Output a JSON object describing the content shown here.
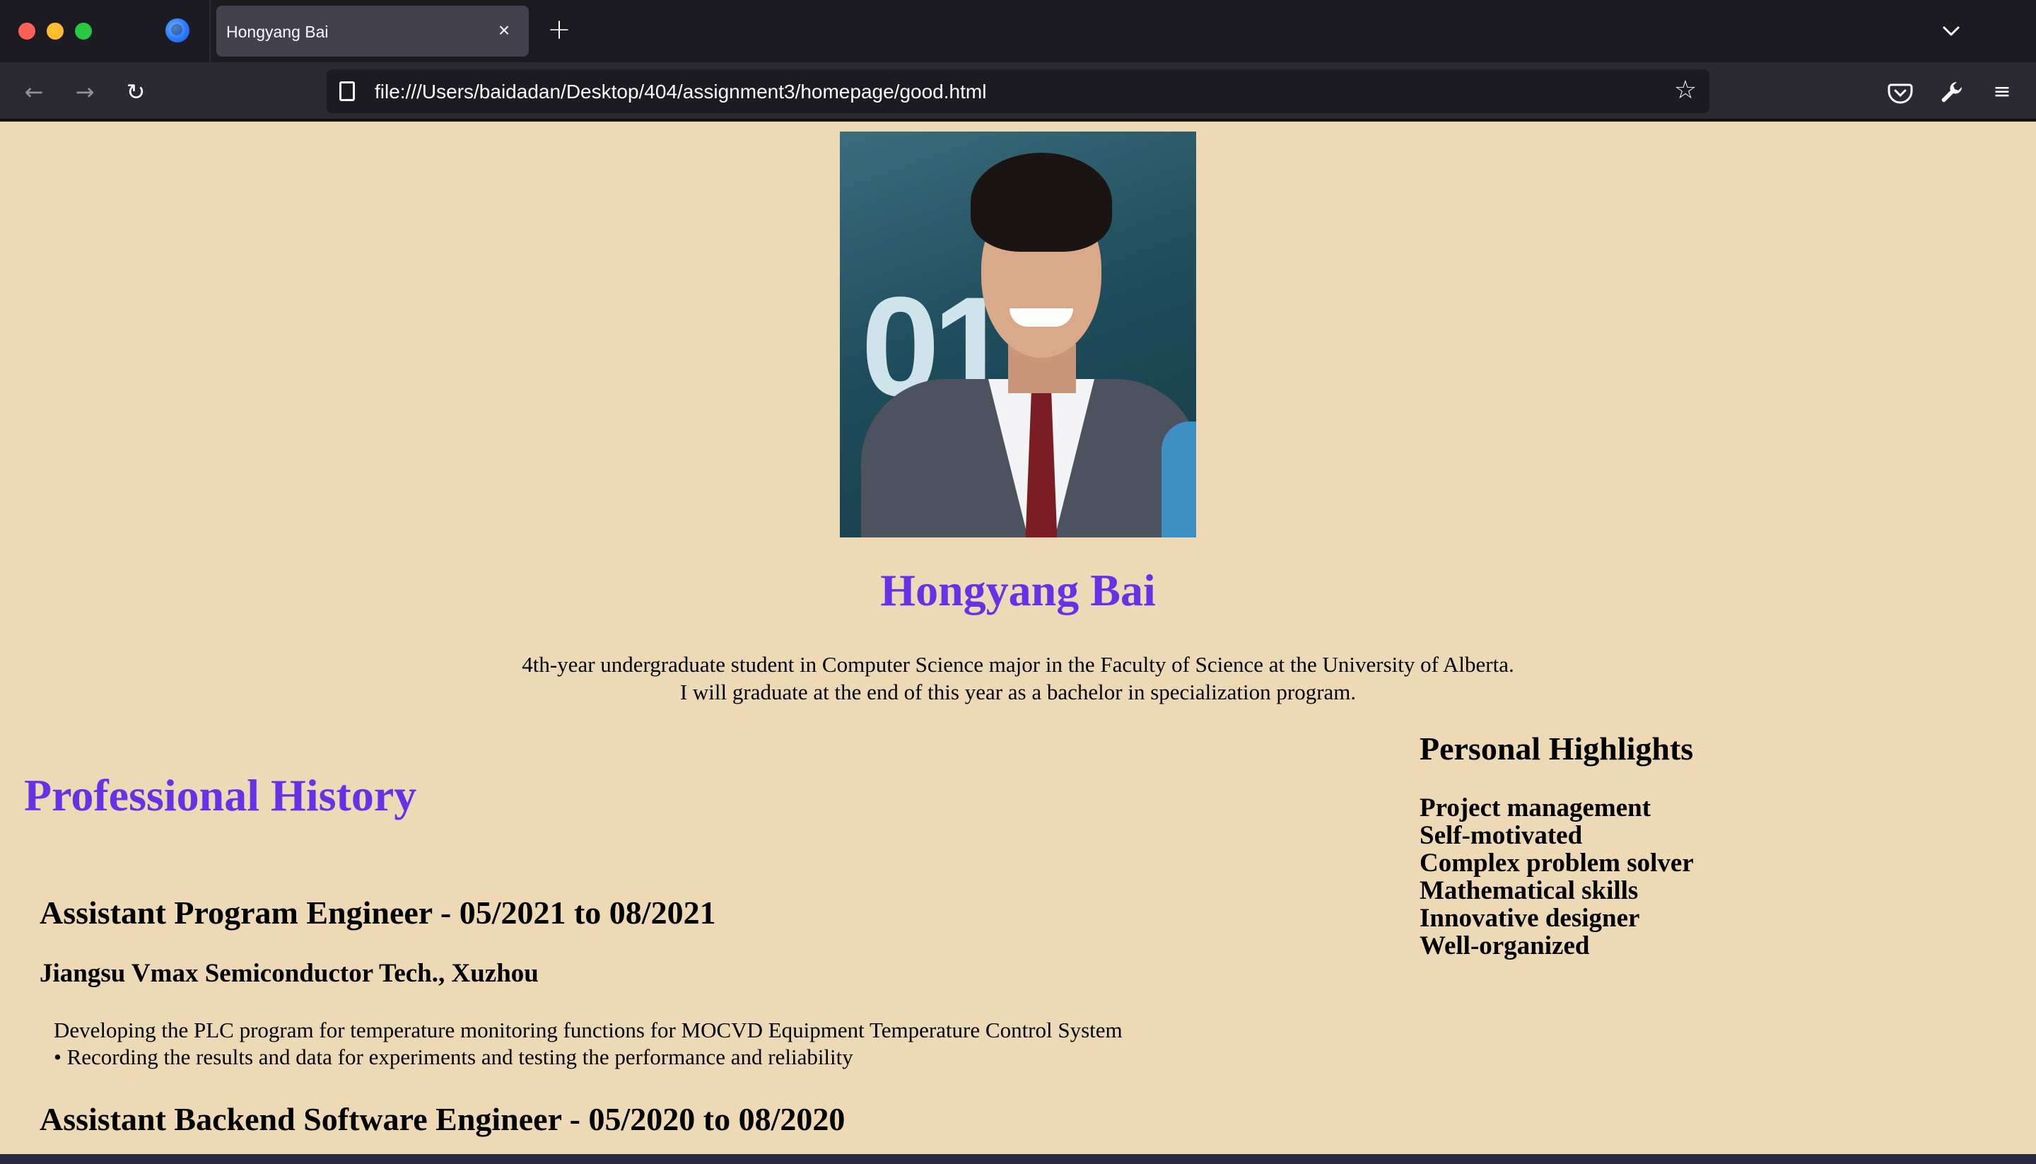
{
  "browser": {
    "tab_title": "Hongyang Bai",
    "tab_close_icon": "×",
    "new_tab_icon": "+",
    "url": "file:///Users/baidadan/Desktop/404/assignment3/homepage/good.html",
    "icons": {
      "back": "←",
      "forward": "→",
      "reload": "↻",
      "bookmark": "☆",
      "pocket": "pocket-icon",
      "wrench": "wrench-icon",
      "menu": "≡",
      "tab_list": "chevron-down-icon"
    }
  },
  "page": {
    "name": "Hongyang Bai",
    "intro_line1": "4th-year undergraduate student in Computer Science major in the Faculty of Science at the University of Alberta.",
    "intro_line2": "I will graduate at the end of this year as a bachelor in specialization program.",
    "highlights": {
      "title": "Personal Highlights",
      "items": [
        "Project management",
        "Self-motivated",
        "Complex problem solver",
        "Mathematical skills",
        "Innovative designer",
        "Well-organized"
      ]
    },
    "history": {
      "title": "Professional History",
      "jobs": [
        {
          "title": "Assistant Program Engineer - 05/2021 to 08/2021",
          "company": "Jiangsu Vmax Semiconductor Tech., Xuzhou",
          "desc_line1": "Developing the PLC program for temperature monitoring functions for MOCVD Equipment Temperature Control System",
          "desc_line2": "• Recording the results and data for experiments and testing the performance and reliability"
        },
        {
          "title": "Assistant Backend Software Engineer - 05/2020 to 08/2020"
        }
      ]
    }
  },
  "colors": {
    "page_background": "#eed9b6",
    "heading_accent": "#6a30e6",
    "chrome_dark": "#1c1b22",
    "chrome_toolbar": "#2b2a33"
  }
}
